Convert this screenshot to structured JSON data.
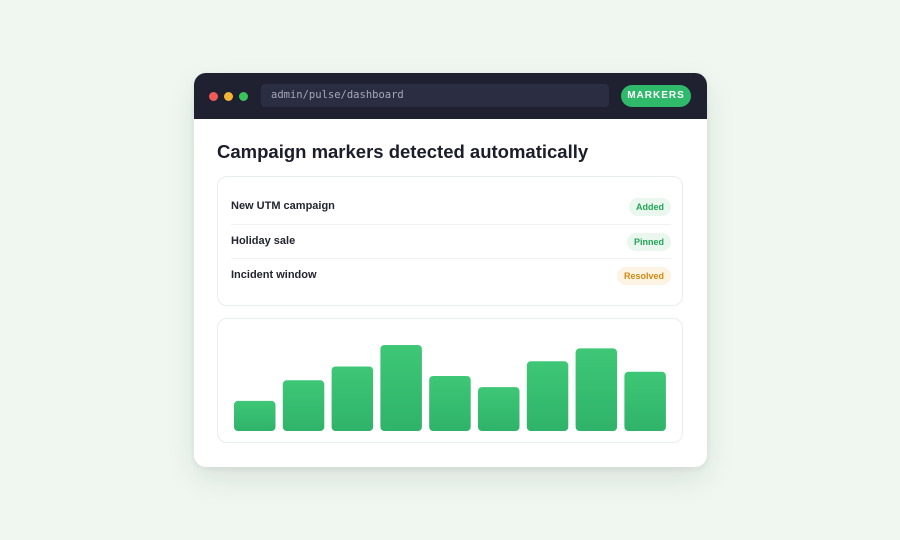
{
  "window": {
    "url": "admin/pulse/dashboard",
    "markers_label": "MARKERS"
  },
  "main": {
    "title": "Campaign markers detected automatically",
    "markers": [
      {
        "label": "New UTM campaign",
        "status": "Added"
      },
      {
        "label": "Holiday sale",
        "status": "Pinned"
      },
      {
        "label": "Incident window",
        "status": "Resolved"
      }
    ]
  },
  "colors": {
    "accent": "#2fb96a",
    "bar": "#35bf6d",
    "titlebar": "#1f2030",
    "badge_green": "#24a458",
    "badge_amber": "#d08b12"
  },
  "chart_data": {
    "type": "bar",
    "values": [
      0.35,
      0.59,
      0.75,
      1.0,
      0.64,
      0.51,
      0.81,
      0.96,
      0.69
    ],
    "ylim": [
      0,
      1
    ],
    "grid": false
  }
}
